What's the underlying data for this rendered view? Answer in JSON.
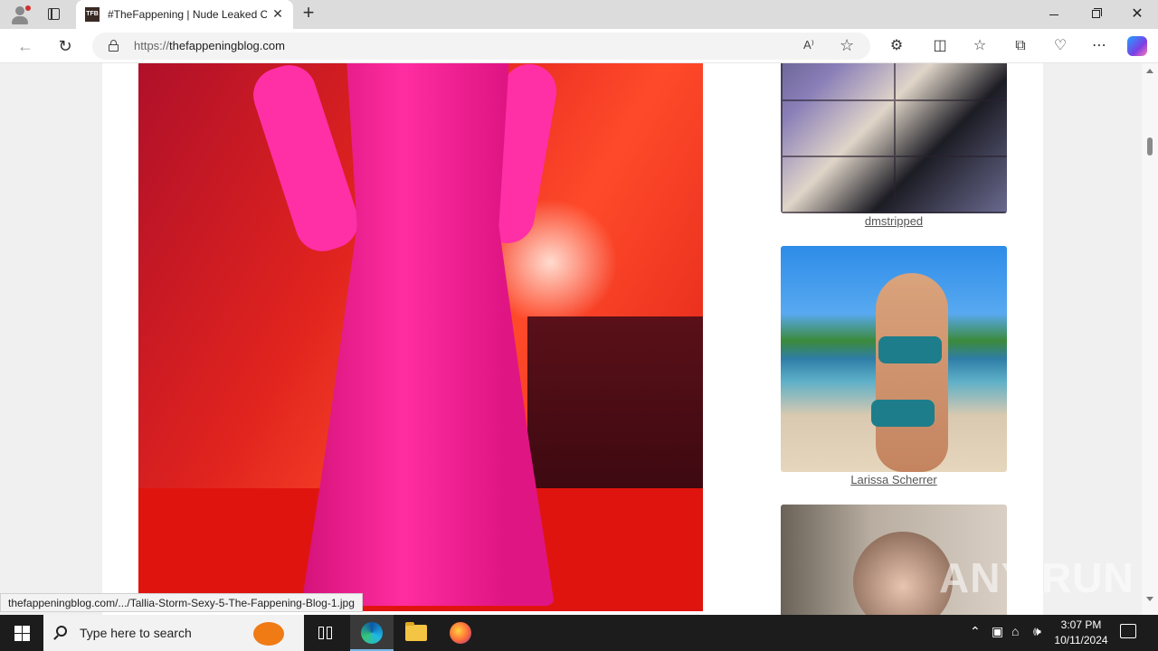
{
  "browser": {
    "tab_title": "#TheFappening | Nude Leaked C",
    "favicon_text": "TFB",
    "url_proto": "https://",
    "url_host": "thefappeningblog.com",
    "icons": [
      "profile-icon",
      "tab-actions-icon",
      "close-icon",
      "new-tab-icon",
      "back-icon",
      "refresh-icon",
      "lock-icon",
      "read-aloud-icon",
      "favorite-star-icon",
      "extensions-icon",
      "split-screen-icon",
      "favorites-icon",
      "collections-icon",
      "browser-essentials-icon",
      "more-icon",
      "copilot-icon"
    ]
  },
  "page": {
    "sidebar": [
      {
        "caption": "dmstripped"
      },
      {
        "caption": "Larissa Scherrer"
      },
      {
        "caption": ""
      }
    ],
    "status_url": "thefappeningblog.com/.../Tallia-Storm-Sexy-5-The-Fappening-Blog-1.jpg",
    "watermark": "ANY RUN"
  },
  "taskbar": {
    "search_placeholder": "Type here to search",
    "time": "3:07 PM",
    "date": "10/11/2024"
  }
}
